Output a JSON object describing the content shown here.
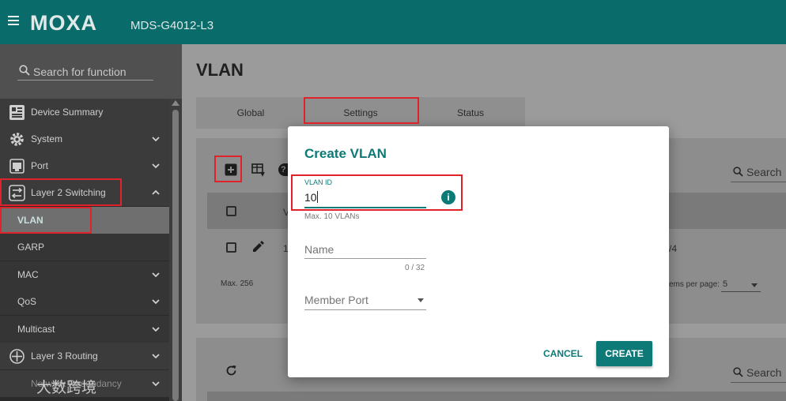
{
  "header": {
    "logo": "MOXA",
    "model": "MDS-G4012-L3"
  },
  "sidebar": {
    "search_placeholder": "Search for function",
    "items": [
      {
        "label": "Device Summary"
      },
      {
        "label": "System"
      },
      {
        "label": "Port"
      },
      {
        "label": "Layer 2 Switching"
      },
      {
        "label": "VLAN"
      },
      {
        "label": "GARP"
      },
      {
        "label": "MAC"
      },
      {
        "label": "QoS"
      },
      {
        "label": "Multicast"
      },
      {
        "label": "Layer 3 Routing"
      },
      {
        "label": "Network Redundancy"
      }
    ],
    "watermark": "大数跨境"
  },
  "main": {
    "title": "VLAN",
    "tabs": [
      {
        "label": "Global"
      },
      {
        "label": "Settings"
      },
      {
        "label": "Status"
      }
    ],
    "table": {
      "header_first_col": "V",
      "row_first_cell": "1",
      "row_last_cell_fragment": "/4",
      "max_text": "Max. 256",
      "items_per_page_label": "ems per page:",
      "items_per_page_value": "5"
    },
    "search_label": "Search",
    "search_label_2": "Search"
  },
  "dialog": {
    "title": "Create VLAN",
    "vlan_id": {
      "label": "VLAN ID",
      "value": "10",
      "hint": "Max. 10 VLANs"
    },
    "name": {
      "placeholder": "Name",
      "counter": "0 / 32"
    },
    "member_port": {
      "placeholder": "Member Port"
    },
    "cancel_label": "CANCEL",
    "create_label": "CREATE"
  },
  "colors": {
    "brand_teal": "#0a6c6a",
    "accent_teal": "#0d7a77",
    "highlight_red": "#e0232b"
  }
}
